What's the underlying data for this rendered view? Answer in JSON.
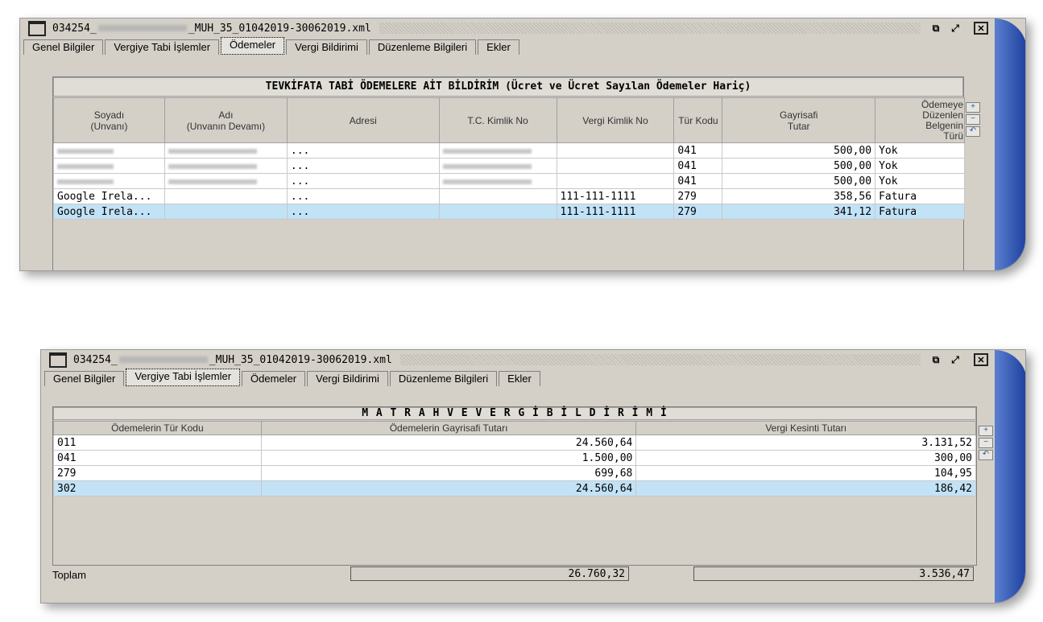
{
  "window1": {
    "title_prefix": "034254_",
    "title_suffix": "_MUH_35_01042019-30062019.xml",
    "tabs": [
      "Genel Bilgiler",
      "Vergiye Tabi İşlemler",
      "Ödemeler",
      "Vergi Bildirimi",
      "Düzenleme Bilgileri",
      "Ekler"
    ],
    "active_tab": 2,
    "grid_title": "TEVKİFATA TABİ ÖDEMELERE AİT BİLDİRİM (Ücret ve Ücret Sayılan Ödemeler Hariç)",
    "columns": [
      {
        "l1": "Soyadı",
        "l2": "(Unvanı)"
      },
      {
        "l1": "Adı",
        "l2": "(Unvanın Devamı)"
      },
      {
        "l1": "Adresi",
        "l2": ""
      },
      {
        "l1": "T.C. Kimlik No",
        "l2": ""
      },
      {
        "l1": "Vergi Kimlik No",
        "l2": ""
      },
      {
        "l1": "Tür Kodu",
        "l2": ""
      },
      {
        "l1": "Gayrisafi",
        "l2": "Tutar"
      },
      {
        "l1": "Ödemeye",
        "l2": "Düzenlen",
        "l3": "Belgenin",
        "l4": "Türü"
      }
    ],
    "rows": [
      {
        "soyadi": "",
        "adi": "",
        "adres": "...",
        "tc": "",
        "vkn": "",
        "tur": "041",
        "tutar": "500,00",
        "belge": "Yok"
      },
      {
        "soyadi": "",
        "adi": "",
        "adres": "...",
        "tc": "",
        "vkn": "",
        "tur": "041",
        "tutar": "500,00",
        "belge": "Yok"
      },
      {
        "soyadi": "",
        "adi": "",
        "adres": "...",
        "tc": "",
        "vkn": "",
        "tur": "041",
        "tutar": "500,00",
        "belge": "Yok"
      },
      {
        "soyadi": "Google Irela...",
        "adi": "",
        "adres": "...",
        "tc": "",
        "vkn": "111-111-1111",
        "tur": "279",
        "tutar": "358,56",
        "belge": "Fatura"
      },
      {
        "soyadi": "Google Irela...",
        "adi": "",
        "adres": "...",
        "tc": "",
        "vkn": "111-111-1111",
        "tur": "279",
        "tutar": "341,12",
        "belge": "Fatura"
      }
    ],
    "selected_row": 4
  },
  "window2": {
    "title_prefix": "034254_",
    "title_suffix": "_MUH_35_01042019-30062019.xml",
    "tabs": [
      "Genel Bilgiler",
      "Vergiye Tabi İşlemler",
      "Ödemeler",
      "Vergi Bildirimi",
      "Düzenleme Bilgileri",
      "Ekler"
    ],
    "active_tab": 1,
    "grid_title": "M A T R A H  V E  V E R G İ   B İ L D İ R İ M İ",
    "columns": [
      "Ödemelerin Tür Kodu",
      "Ödemelerin Gayrisafi Tutarı",
      "Vergi Kesinti Tutarı"
    ],
    "rows": [
      {
        "kod": "011",
        "gayrisafi": "24.560,64",
        "kesinti": "3.131,52"
      },
      {
        "kod": "041",
        "gayrisafi": "1.500,00",
        "kesinti": "300,00"
      },
      {
        "kod": "279",
        "gayrisafi": "699,68",
        "kesinti": "104,95"
      },
      {
        "kod": "302",
        "gayrisafi": "24.560,64",
        "kesinti": "186,42"
      }
    ],
    "selected_row": 3,
    "total_label": "Toplam",
    "total_gayrisafi": "26.760,32",
    "total_kesinti": "3.536,47"
  },
  "icons": {
    "add": "+",
    "remove": "−",
    "undo": "↶"
  },
  "colors": {
    "selection": "#c2e2f6",
    "window_bg": "#d4d0c8",
    "accent": "#1d3f9e"
  }
}
